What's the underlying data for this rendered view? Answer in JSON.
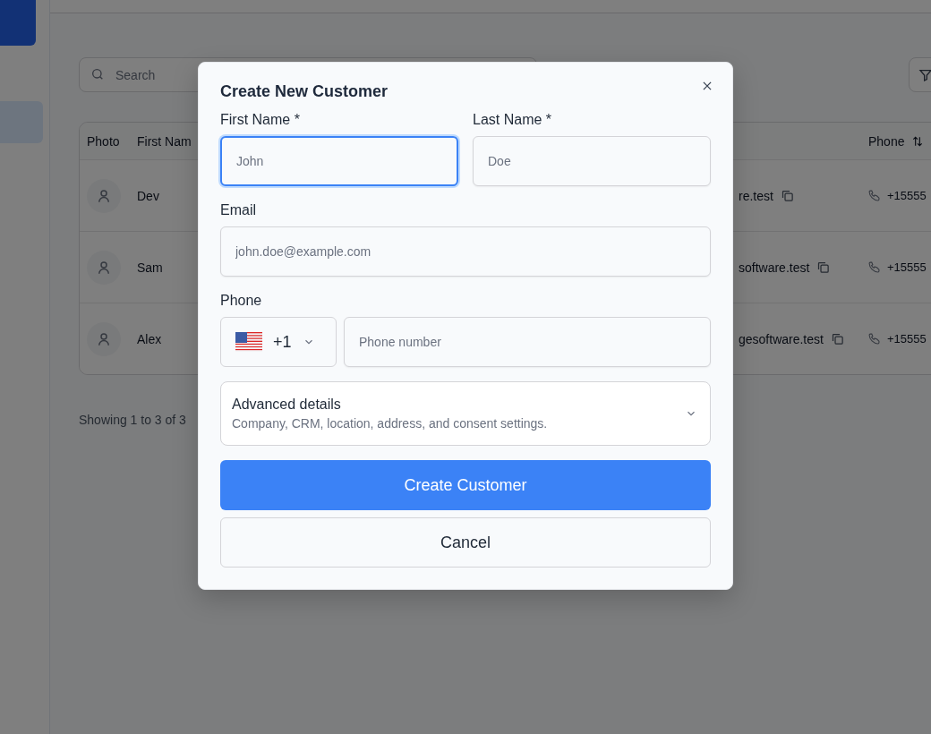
{
  "page": {
    "search": {
      "placeholder": "Search"
    },
    "table": {
      "columns": [
        "Photo",
        "First Nam",
        "Phone"
      ],
      "rows": [
        {
          "first_name": "Dev",
          "email": "re.test",
          "phone": "+15555"
        },
        {
          "first_name": "Sam",
          "email": "software.test",
          "phone": "+15555"
        },
        {
          "first_name": "Alex",
          "email": "gesoftware.test",
          "phone": "+15555"
        }
      ]
    },
    "footer": "Showing 1 to 3 of 3"
  },
  "dialog": {
    "title": "Create New Customer",
    "fields": [
      {
        "kind": "text",
        "label": "First Name *",
        "placeholder": "John",
        "focused": true
      },
      {
        "kind": "text",
        "label": "Last Name *",
        "placeholder": "Doe",
        "focused": false
      },
      {
        "kind": "text",
        "label": "Email",
        "placeholder": "john.doe@example.com",
        "focused": false
      },
      {
        "kind": "phone",
        "label": "Phone",
        "country_code": "+1",
        "placeholder": "Phone number",
        "focused": false
      }
    ],
    "advanced": {
      "title": "Advanced details",
      "description": "Company, CRM, location, address, and consent settings.",
      "expanded": false
    },
    "buttons": [
      {
        "label": "Create Customer",
        "kind": "primary"
      },
      {
        "label": "Cancel",
        "kind": "secondary"
      }
    ]
  }
}
